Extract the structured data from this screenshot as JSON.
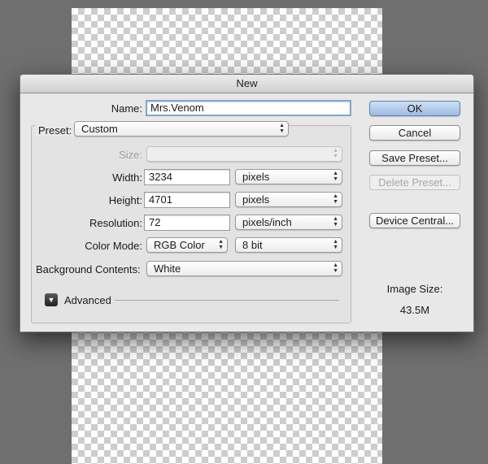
{
  "dialog": {
    "title": "New"
  },
  "form": {
    "name": {
      "label": "Name:",
      "value": "Mrs.Venom"
    },
    "preset": {
      "label": "Preset:",
      "value": "Custom"
    },
    "size": {
      "label": "Size:",
      "value": ""
    },
    "width": {
      "label": "Width:",
      "value": "3234",
      "unit": "pixels"
    },
    "height": {
      "label": "Height:",
      "value": "4701",
      "unit": "pixels"
    },
    "resolution": {
      "label": "Resolution:",
      "value": "72",
      "unit": "pixels/inch"
    },
    "color_mode": {
      "label": "Color Mode:",
      "value": "RGB Color",
      "bit_depth": "8 bit"
    },
    "background": {
      "label": "Background Contents:",
      "value": "White"
    },
    "advanced": {
      "label": "Advanced"
    }
  },
  "buttons": {
    "ok": "OK",
    "cancel": "Cancel",
    "save_preset": "Save Preset...",
    "delete_preset": "Delete Preset...",
    "device_central": "Device Central..."
  },
  "image_size": {
    "label": "Image Size:",
    "value": "43.5M"
  },
  "colors": {
    "default_button": "#9dbbe2",
    "focus_ring": "#7fa4d8",
    "background": "#6f6f6f"
  },
  "icons": {
    "popup_arrows": "updown-arrows-icon",
    "disclosure": "disclosure-triangle-icon"
  }
}
